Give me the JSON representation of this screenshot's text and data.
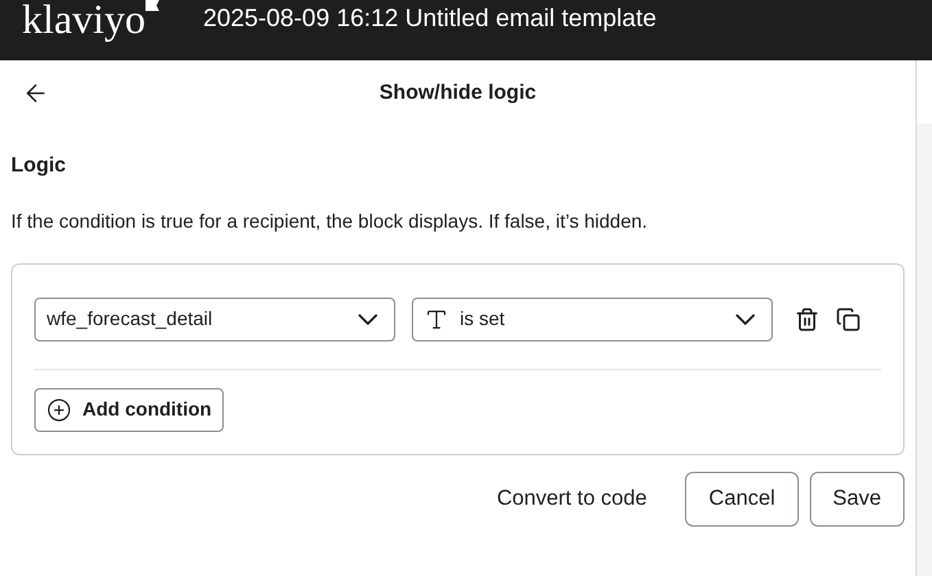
{
  "header": {
    "logo": "klaviyo",
    "title": "2025-08-09 16:12 Untitled email template"
  },
  "panel": {
    "title": "Show/hide logic"
  },
  "logic": {
    "heading": "Logic",
    "description": "If the condition is true for a recipient, the block displays. If false, it’s hidden.",
    "conditions": [
      {
        "property": "wfe_forecast_detail",
        "operator": "is set"
      }
    ],
    "add_button": "Add condition"
  },
  "footer": {
    "convert_link": "Convert to code",
    "buttons": [
      "Cancel",
      "Save"
    ]
  }
}
